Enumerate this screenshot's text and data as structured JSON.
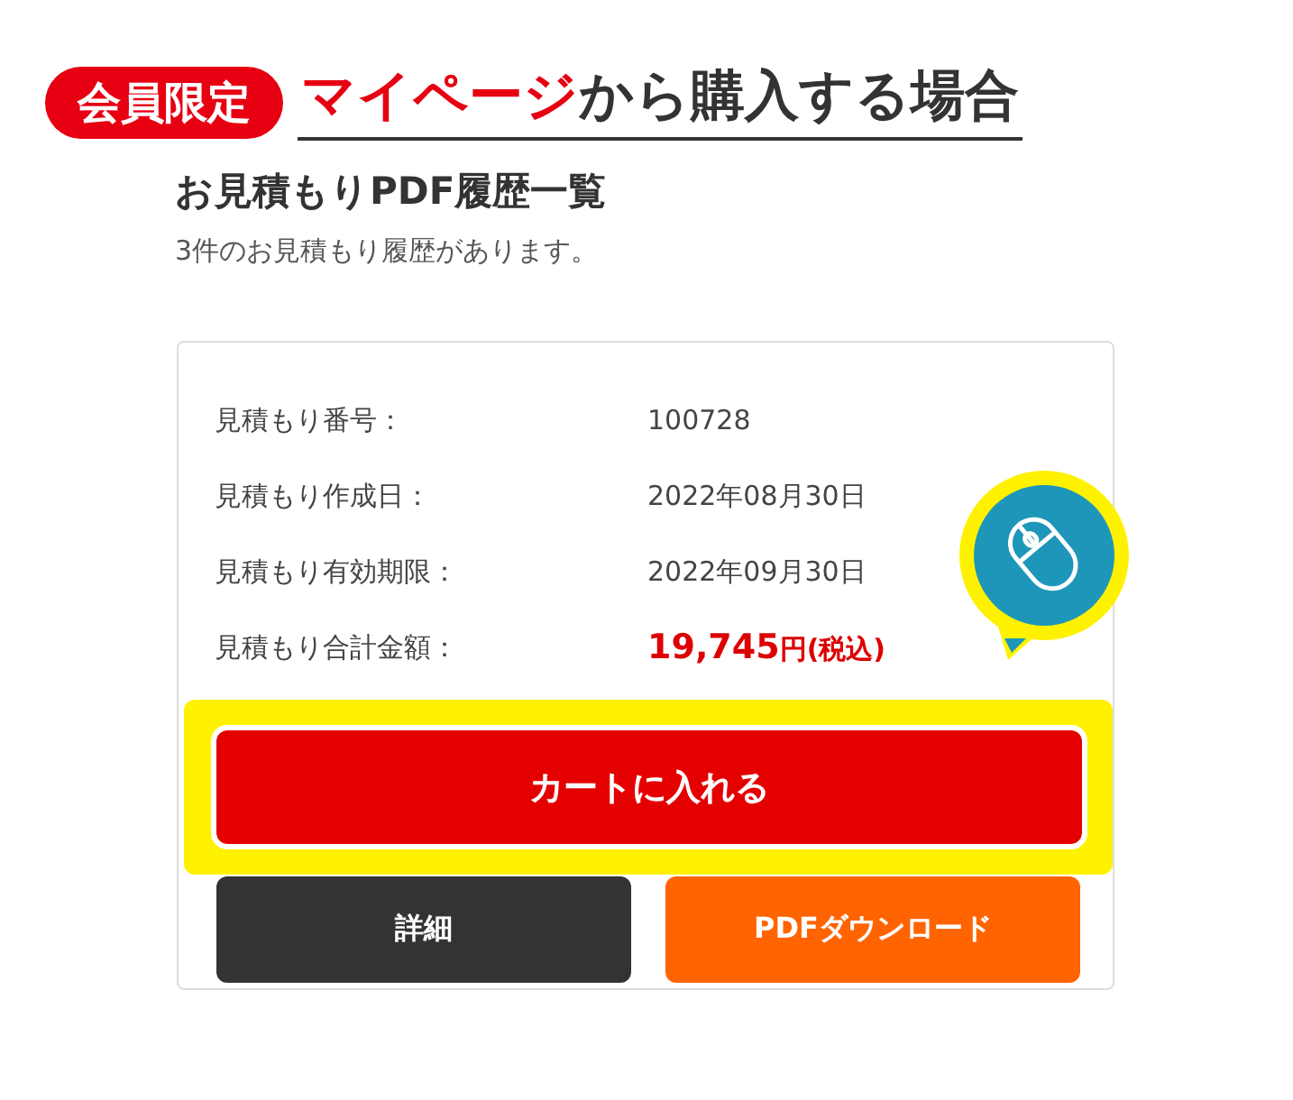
{
  "banner": {
    "badge": "会員限定",
    "title_highlight": "マイページ",
    "title_rest": "から購入する場合"
  },
  "heading": "お見積もりPDF履歴一覧",
  "subtitle": "3件のお見積もり履歴があります。",
  "details": [
    {
      "kind": "plain",
      "label": "見積もり番号：",
      "value": "100728"
    },
    {
      "kind": "plain",
      "label": "見積もり作成日：",
      "value": "2022年08月30日"
    },
    {
      "kind": "plain",
      "label": "見積もり有効期限：",
      "value": "2022年09月30日"
    },
    {
      "kind": "price",
      "label": "見積もり合計金額：",
      "value": "19,745",
      "suffix": "円(税込)"
    }
  ],
  "cart_button": {
    "label": "カートに入れる",
    "highlighted": true
  },
  "buttons": [
    {
      "kind": "dark",
      "label": "詳細"
    },
    {
      "kind": "orange",
      "label": "PDFダウンロード"
    }
  ]
}
